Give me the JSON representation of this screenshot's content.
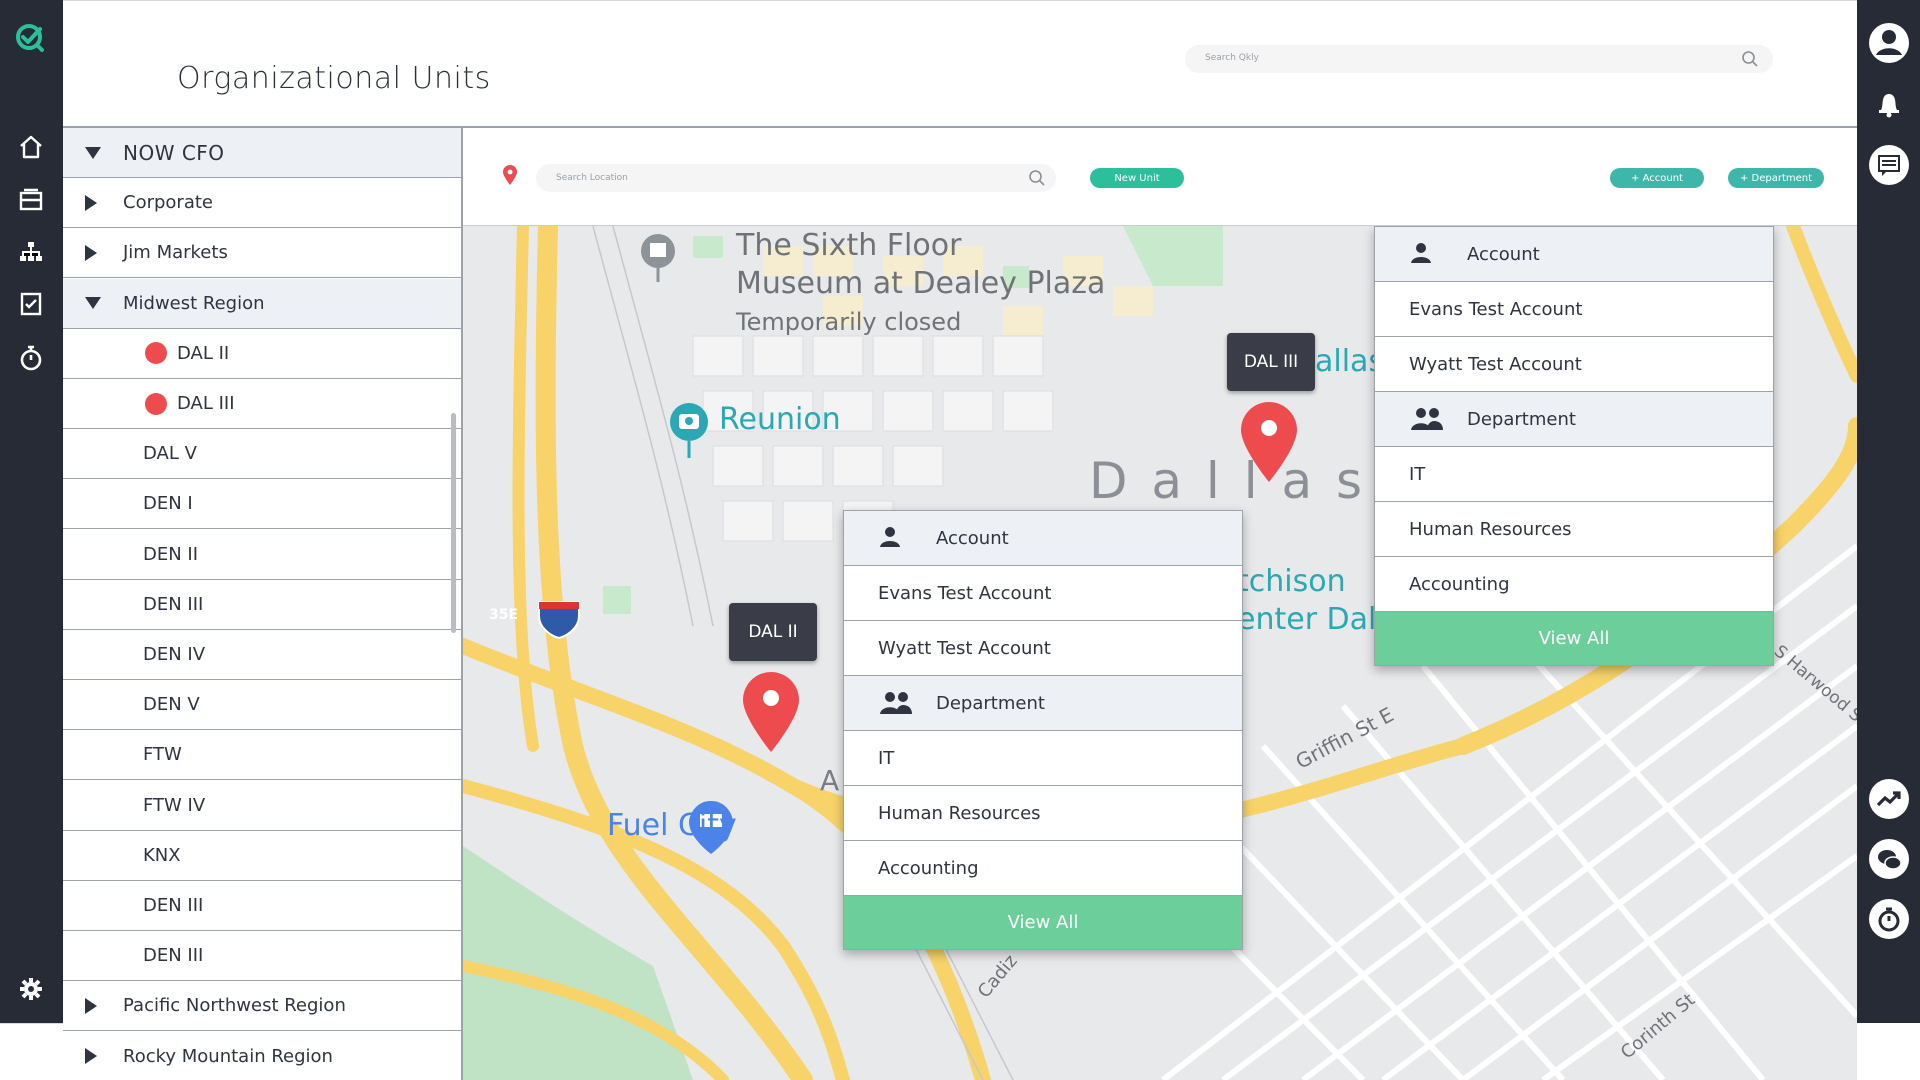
{
  "header": {
    "title": "Organizational Units",
    "search_placeholder": "Search Qkly"
  },
  "left_rail": {
    "items": [
      {
        "name": "logo-icon"
      },
      {
        "name": "home-icon"
      },
      {
        "name": "inbox-icon"
      },
      {
        "name": "org-chart-icon"
      },
      {
        "name": "checklist-icon"
      },
      {
        "name": "timer-icon"
      },
      {
        "name": "gear-icon"
      }
    ]
  },
  "right_rail": {
    "items": [
      {
        "name": "profile-icon"
      },
      {
        "name": "bell-icon"
      },
      {
        "name": "message-icon"
      },
      {
        "name": "trend-icon"
      },
      {
        "name": "chat-icon"
      },
      {
        "name": "stopwatch-icon"
      }
    ]
  },
  "tree": {
    "items": [
      {
        "label": "NOW CFO",
        "expand": "down",
        "level": 0,
        "shaded": true
      },
      {
        "label": "Corporate",
        "expand": "right",
        "level": 0,
        "shaded": false
      },
      {
        "label": "Jim Markets",
        "expand": "right",
        "level": 0,
        "shaded": false
      },
      {
        "label": "Midwest Region",
        "expand": "down",
        "level": 0,
        "shaded": true
      },
      {
        "label": "DAL II",
        "dot": true,
        "level": 1
      },
      {
        "label": "DAL III",
        "dot": true,
        "level": 1
      },
      {
        "label": "DAL V",
        "level": 1
      },
      {
        "label": "DEN I",
        "level": 1
      },
      {
        "label": "DEN II",
        "level": 1
      },
      {
        "label": "DEN III",
        "level": 1
      },
      {
        "label": "DEN IV",
        "level": 1
      },
      {
        "label": "DEN V",
        "level": 1
      },
      {
        "label": "FTW",
        "level": 1
      },
      {
        "label": "FTW IV",
        "level": 1
      },
      {
        "label": "KNX",
        "level": 1
      },
      {
        "label": "DEN III",
        "level": 1
      },
      {
        "label": "DEN III",
        "level": 1
      },
      {
        "label": "Pacific Northwest Region",
        "expand": "right",
        "level": 0
      },
      {
        "label": "Rocky Mountain Region",
        "expand": "right",
        "level": 0
      }
    ]
  },
  "toolbar": {
    "location_placeholder": "Search Location",
    "new_unit": "New Unit",
    "add_account": "+ Account",
    "add_department": "+ Department"
  },
  "map": {
    "labels": {
      "museum_line1": "The Sixth Floor",
      "museum_line2": "Museum at Dealey Plaza",
      "museum_status": "Temporarily closed",
      "reunion": "Reunion",
      "dallas": "D a l l a s",
      "dallas_partial": "allas",
      "hutchison_1": "tchison",
      "hutchison_2": "enter Dal",
      "griffin": "Griffin St E",
      "harwood": "S Harwood St",
      "cadiz": "Cadiz",
      "corinth": "Corinth St",
      "fuel_city": "Fuel City",
      "interstate": "35E",
      "letter_a": "A"
    },
    "pins": [
      {
        "tag": "DAL II",
        "color": "#ee4b4f"
      },
      {
        "tag": "DAL III",
        "color": "#ee4b4f"
      }
    ],
    "colors": {
      "highway": "#f7d36a",
      "park": "#bfe3c4",
      "water": "#aadaff",
      "block": "#f6f6f6"
    }
  },
  "popups": [
    {
      "account_header": "Account",
      "accounts": [
        "Evans Test Account",
        "Wyatt Test Account"
      ],
      "department_header": "Department",
      "departments": [
        "IT",
        "Human Resources",
        "Accounting"
      ],
      "view_all": "View All"
    },
    {
      "account_header": "Account",
      "accounts": [
        "Evans Test Account",
        "Wyatt Test Account"
      ],
      "department_header": "Department",
      "departments": [
        "IT",
        "Human Resources",
        "Accounting"
      ],
      "view_all": "View All"
    }
  ],
  "theme": {
    "rail": "#262b36",
    "accent": "#2bbf9b",
    "view_all": "#6ccf9b",
    "dot": "#ee4b4f"
  }
}
